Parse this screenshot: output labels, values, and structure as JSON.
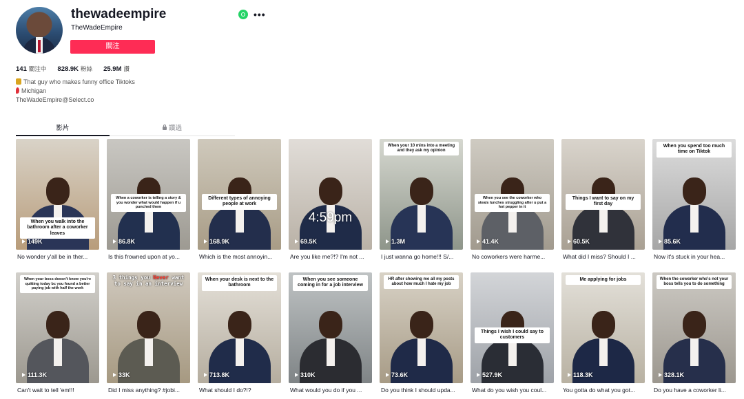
{
  "profile": {
    "username": "thewadeempire",
    "nickname": "TheWadeEmpire",
    "follow_label": "關注",
    "stats": [
      {
        "value": "141",
        "label": "關注中"
      },
      {
        "value": "828.9K",
        "label": "粉絲"
      },
      {
        "value": "25.9M",
        "label": "讚"
      }
    ],
    "bio": [
      {
        "icon": "medal-emoji-icon",
        "color": "#d9a520",
        "text": "That guy who makes funny office Tiktoks"
      },
      {
        "icon": "location-pin-emoji-icon",
        "color": "#e0303a",
        "text": "Michigan"
      },
      {
        "icon": "",
        "color": "",
        "text": "TheWadeEmpire@Select.co"
      }
    ]
  },
  "tabs": [
    {
      "label": "影片",
      "active": true
    },
    {
      "label": "讚過",
      "active": false,
      "icon": "lock-icon"
    }
  ],
  "videos": [
    {
      "views": "149K",
      "caption": "No wonder y'all be in ther...",
      "overlay": "When you walk into the bathroom after a coworker leaves",
      "overlay_pos": "bottom"
    },
    {
      "views": "86.8K",
      "caption": "Is this frowned upon at yo...",
      "overlay": "When a coworker is telling a story & you wonder what would happen if u punched them",
      "overlay_pos": "mid"
    },
    {
      "views": "168.9K",
      "caption": "Which is the most annoyin...",
      "overlay": "Different types of annoying people at work",
      "overlay_pos": "mid"
    },
    {
      "views": "69.5K",
      "caption": "Are you like me?!? I'm not ...",
      "overlay": "4:59pm",
      "overlay_pos": "time"
    },
    {
      "views": "1.3M",
      "caption": "I just wanna go home!!! S/...",
      "overlay": "When your 10 mins into a meeting and they ask my opinion",
      "overlay_pos": "top"
    },
    {
      "views": "41.4K",
      "caption": "No coworkers were harme...",
      "overlay": "When you see the coworker who steals lunches struggling after u put a hot pepper in it",
      "overlay_pos": "mid"
    },
    {
      "views": "60.5K",
      "caption": "What did I miss? Should I ...",
      "overlay": "Things I want to say on my first day",
      "overlay_pos": "mid"
    },
    {
      "views": "85.6K",
      "caption": "Now it's stuck in your hea...",
      "overlay": "When you spend too much time on Tiktok",
      "overlay_pos": "top"
    },
    {
      "views": "111.3K",
      "caption": "Can't wait to tell 'em!!!",
      "overlay": "When your boss doesn't know you're quitting today bc you found a better paying job with half the work",
      "overlay_pos": "top"
    },
    {
      "views": "33K",
      "caption": "Did I miss anything? #jobi...",
      "overlay": "3 things you Never want to say in an interview",
      "overlay_pos": "head"
    },
    {
      "views": "713.8K",
      "caption": "What should I do?!?",
      "overlay": "When your desk is next to the bathroom",
      "overlay_pos": "top"
    },
    {
      "views": "310K",
      "caption": "What would you do if you ...",
      "overlay": "When you see someone coming in for a job interview",
      "overlay_pos": "top"
    },
    {
      "views": "73.6K",
      "caption": "Do you think I should upda...",
      "overlay": "HR after showing me all my posts about how much I hate my job",
      "overlay_pos": "top"
    },
    {
      "views": "527.9K",
      "caption": "What do you wish you coul...",
      "overlay": "Things I wish I could say to customers",
      "overlay_pos": "mid"
    },
    {
      "views": "118.3K",
      "caption": "You gotta do what you got...",
      "overlay": "Me applying for jobs",
      "overlay_pos": "top"
    },
    {
      "views": "328.1K",
      "caption": "Do you have a coworker li...",
      "overlay": "When the coworker who's not your boss tells you to do something",
      "overlay_pos": "top"
    }
  ]
}
